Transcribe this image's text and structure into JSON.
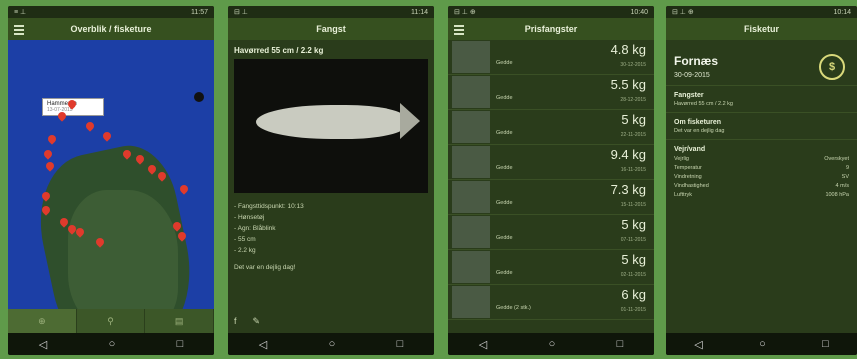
{
  "phone1": {
    "status": "11:57",
    "title": "Overblik / fisketure",
    "callout_title": "Hammeren",
    "callout_sub": "13-07-2015",
    "tabs": [
      "⊕",
      "⚲",
      "▤"
    ]
  },
  "phone2": {
    "status": "11:14",
    "title": "Fangst",
    "catch_title": "Havørred 55 cm / 2.2 kg",
    "details": [
      "- Fangsttidspunkt: 10:13",
      "- Hønsetøj",
      "- Agn: Blåblink",
      "- 55 cm",
      "- 2.2 kg"
    ],
    "note": "Det var en dejlig dag!",
    "share": [
      "f",
      "✎"
    ]
  },
  "phone3": {
    "status": "10:40",
    "title": "Prisfangster",
    "rows": [
      {
        "kg": "4.8 kg",
        "name": "Gedde",
        "date": "30-12-2015"
      },
      {
        "kg": "5.5 kg",
        "name": "Gedde",
        "date": "28-12-2015"
      },
      {
        "kg": "5 kg",
        "name": "Gedde",
        "date": "22-11-2015"
      },
      {
        "kg": "9.4 kg",
        "name": "Gedde",
        "date": "16-11-2015"
      },
      {
        "kg": "7.3 kg",
        "name": "Gedde",
        "date": "15-11-2015"
      },
      {
        "kg": "5 kg",
        "name": "Gedde",
        "date": "07-11-2015"
      },
      {
        "kg": "5 kg",
        "name": "Gedde",
        "date": "02-11-2015"
      },
      {
        "kg": "6 kg",
        "name": "Gedde (2 stk.)",
        "date": "01-11-2015"
      }
    ]
  },
  "phone4": {
    "status": "10:14",
    "title": "Fisketur",
    "location": "Fornæs",
    "date": "30-09-2015",
    "fangster_h": "Fangster",
    "fangster_p": "Havørred 55 cm / 2.2 kg",
    "tur_h": "Om fisketuren",
    "tur_p": "Det var en dejlig dag",
    "vejr_h": "Vejr/vand",
    "weather": [
      {
        "k": "Vejrlig",
        "v": "Overskyet"
      },
      {
        "k": "Temperatur",
        "v": "9"
      },
      {
        "k": "Vindretning",
        "v": "SV"
      },
      {
        "k": "Vindhastighed",
        "v": "4 m/s"
      },
      {
        "k": "Lufttryk",
        "v": "1008 hPa"
      }
    ]
  }
}
